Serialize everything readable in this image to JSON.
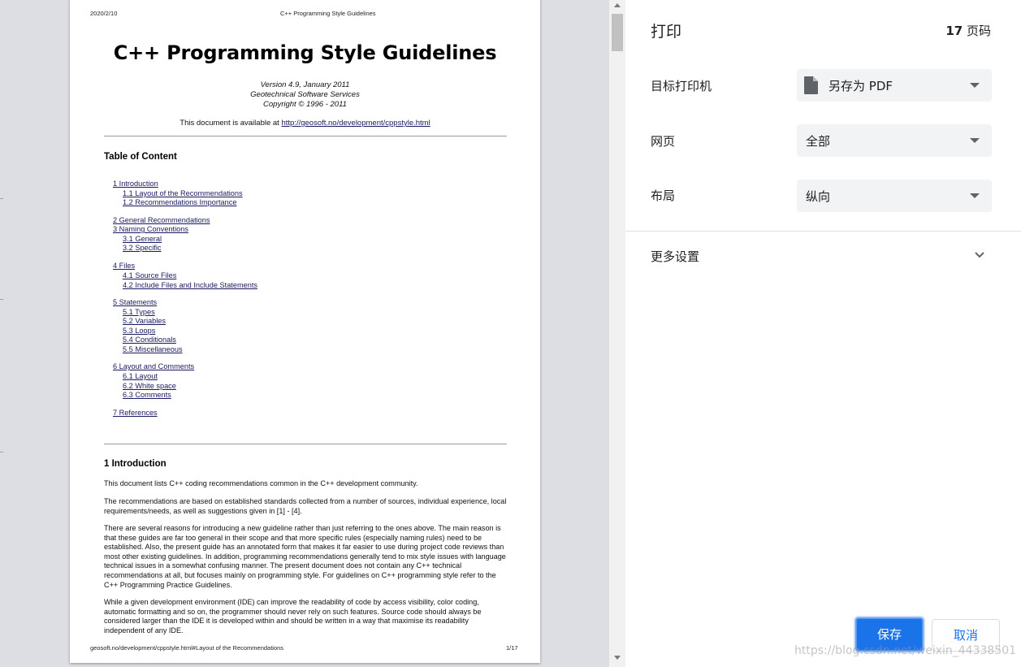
{
  "preview": {
    "header_date": "2020/2/10",
    "header_title": "C++ Programming Style Guidelines",
    "title": "C++ Programming Style Guidelines",
    "version": "Version 4.9, January 2011",
    "org": "Geotechnical Software Services",
    "copyright": "Copyright © 1996 - 2011",
    "availability_prefix": "This document is available at ",
    "availability_url": "http://geosoft.no/development/cppstyle.html",
    "toc_heading": "Table of Content",
    "toc": [
      {
        "text": "1 Introduction",
        "indent": 0
      },
      {
        "text": "1.1 Layout of the Recommendations",
        "indent": 1
      },
      {
        "text": "1.2 Recommendations Importance",
        "indent": 1
      },
      {
        "text": "2 General Recommendations",
        "indent": 0
      },
      {
        "text": "3 Naming Conventions",
        "indent": 0
      },
      {
        "text": "3.1 General",
        "indent": 1
      },
      {
        "text": "3.2 Specific",
        "indent": 1
      },
      {
        "text": "4 Files",
        "indent": 0
      },
      {
        "text": "4.1 Source Files",
        "indent": 1
      },
      {
        "text": "4.2 Include Files and Include Statements",
        "indent": 1
      },
      {
        "text": "5 Statements",
        "indent": 0
      },
      {
        "text": "5.1 Types",
        "indent": 1
      },
      {
        "text": "5.2 Variables",
        "indent": 1
      },
      {
        "text": "5.3 Loops",
        "indent": 1
      },
      {
        "text": "5.4 Conditionals",
        "indent": 1
      },
      {
        "text": "5.5 Miscellaneous",
        "indent": 1
      },
      {
        "text": "6 Layout and Comments",
        "indent": 0
      },
      {
        "text": "6.1 Layout",
        "indent": 1
      },
      {
        "text": "6.2 White space",
        "indent": 1
      },
      {
        "text": "6.3 Comments",
        "indent": 1
      },
      {
        "text": "7 References",
        "indent": 0
      }
    ],
    "section_heading": "1 Introduction",
    "para1": "This document lists C++ coding recommendations common in the C++ development community.",
    "para2": "The recommendations are based on established standards collected from a number of sources, individual experience, local requirements/needs, as well as suggestions given in [1] - [4].",
    "para3": "There are several reasons for introducing a new guideline rather than just referring to the ones above. The main reason is that these guides are far too general in their scope and that more specific rules (especially naming rules) need to be established. Also, the present guide has an annotated form that makes it far easier to use during project code reviews than most other existing guidelines. In addition, programming recommendations generally tend to mix style issues with language technical issues in a somewhat confusing manner. The present document does not contain any C++ technical recommendations at all, but focuses mainly on programming style. For guidelines on C++ programming style refer to the C++ Programming Practice Guidelines.",
    "para4": "While a given development environment (IDE) can improve the readability of code by access visibility, color coding, automatic formatting and so on, the programmer should never rely on such features. Source code should always be considered larger than the IDE it is developed within and should be written in a way that maximise its readability independent of any IDE.",
    "footer_url": "geosoft.no/development/cppstyle.html#Layout of the Recommendations",
    "footer_page": "1/17"
  },
  "sidebar": {
    "title": "打印",
    "page_count_num": "17",
    "page_count_unit": " 页码",
    "destination_label": "目标打印机",
    "destination_value": "另存为 PDF",
    "pages_label": "网页",
    "pages_value": "全部",
    "layout_label": "布局",
    "layout_value": "纵向",
    "more_settings": "更多设置",
    "save_button": "保存",
    "cancel_button": "取消"
  },
  "watermark": "https://blog.csdn.net/weixin_44338501",
  "colors": {
    "accent": "#1a73e8",
    "select_bg": "#f1f3f4",
    "preview_bg": "#dcdee3"
  }
}
